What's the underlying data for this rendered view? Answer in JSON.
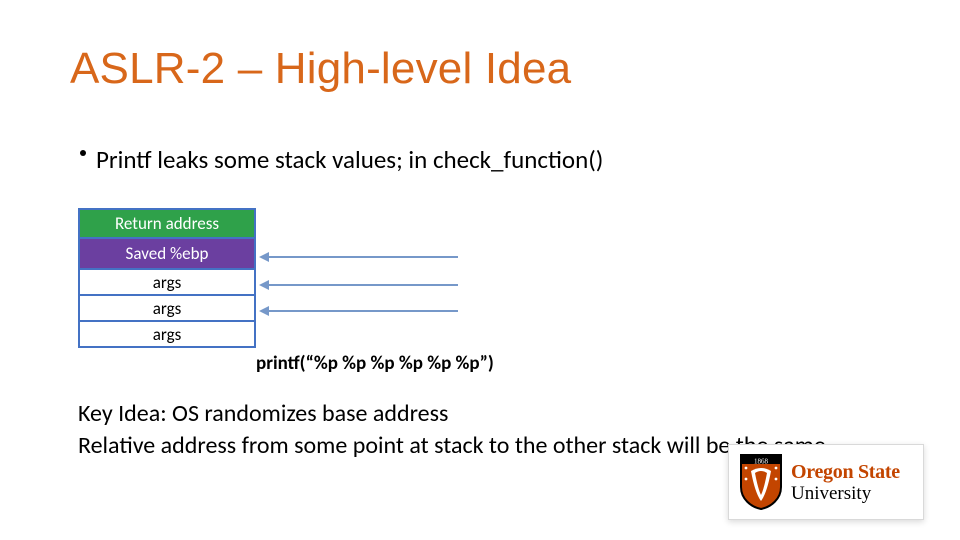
{
  "title": "ASLR-2 – High-level Idea",
  "bullet": "Printf leaks some stack values; in check_function()",
  "stack": {
    "return_address": "Return address",
    "saved_ebp": "Saved %ebp",
    "args": [
      "args",
      "args",
      "args"
    ]
  },
  "printf_call": "printf(“%p %p %p %p %p %p”)",
  "key_idea_line1": "Key Idea: OS randomizes base address",
  "key_idea_line2": "Relative address from some point at stack to the other stack will be the same",
  "logo": {
    "line1": "Oregon State",
    "line2": "University",
    "colors": {
      "orange": "#c34500",
      "black": "#000000"
    }
  }
}
